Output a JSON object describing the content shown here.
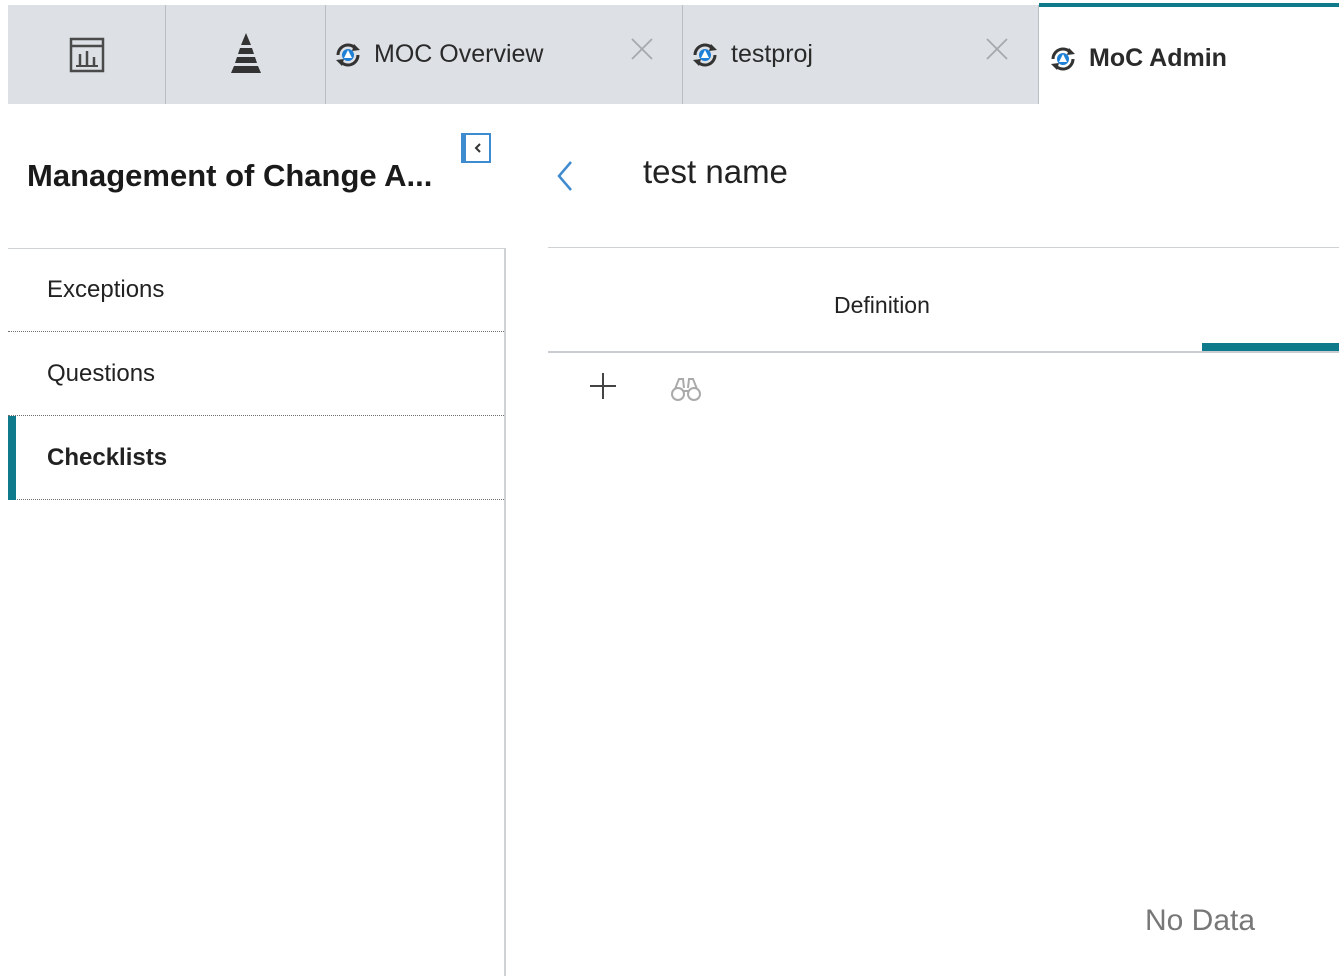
{
  "tabs": [
    {
      "icon": "dashboard-chart-icon"
    },
    {
      "icon": "pyramid-icon"
    },
    {
      "icon": "moc-icon",
      "label": "MOC Overview",
      "closable": true
    },
    {
      "icon": "moc-icon",
      "label": "testproj",
      "closable": true
    },
    {
      "icon": "moc-icon",
      "label": "MoC Admin",
      "active": true
    }
  ],
  "left_panel": {
    "title": "Management of Change A...",
    "items": [
      {
        "label": "Exceptions"
      },
      {
        "label": "Questions"
      },
      {
        "label": "Checklists",
        "active": true
      }
    ]
  },
  "detail": {
    "title": "test name",
    "subtabs": [
      {
        "label": "Definition",
        "active": true
      }
    ],
    "toolbar": {
      "add_icon": "plus-icon",
      "search_icon": "binoculars-icon"
    },
    "empty_text": "No Data"
  },
  "colors": {
    "accent": "#0f7a8c",
    "tabbar_bg": "#dde1e5",
    "link_blue": "#3f8bd0"
  }
}
